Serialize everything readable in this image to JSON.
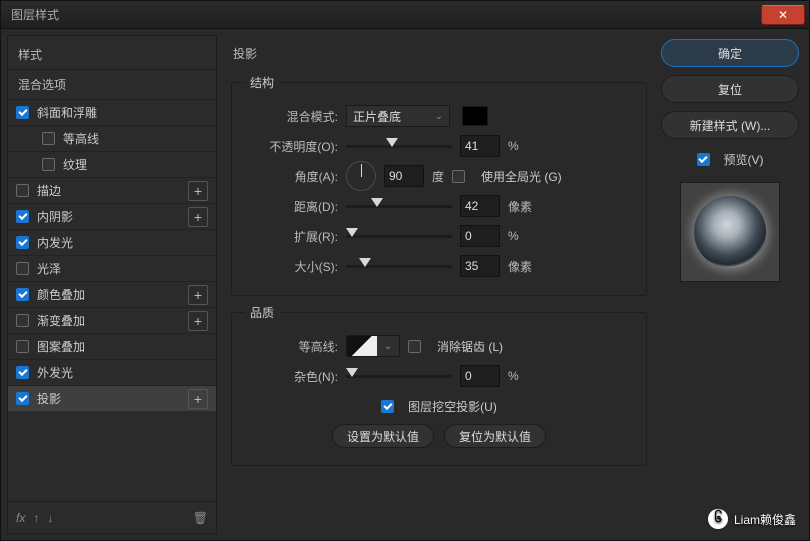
{
  "window": {
    "title": "图层样式"
  },
  "left": {
    "styles": "样式",
    "blendOptions": "混合选项",
    "items": [
      {
        "key": "bevel",
        "label": "斜面和浮雕",
        "checked": true,
        "plus": false
      },
      {
        "key": "contour",
        "label": "等高线",
        "checked": false,
        "plus": false,
        "indent": true
      },
      {
        "key": "texture",
        "label": "纹理",
        "checked": false,
        "plus": false,
        "indent": true
      },
      {
        "key": "stroke",
        "label": "描边",
        "checked": false,
        "plus": true
      },
      {
        "key": "innerShadow",
        "label": "内阴影",
        "checked": true,
        "plus": true
      },
      {
        "key": "innerGlow",
        "label": "内发光",
        "checked": true,
        "plus": false
      },
      {
        "key": "satin",
        "label": "光泽",
        "checked": false,
        "plus": false
      },
      {
        "key": "colorOverlay",
        "label": "颜色叠加",
        "checked": true,
        "plus": true
      },
      {
        "key": "gradOverlay",
        "label": "渐变叠加",
        "checked": false,
        "plus": true
      },
      {
        "key": "patOverlay",
        "label": "图案叠加",
        "checked": false,
        "plus": false
      },
      {
        "key": "outerGlow",
        "label": "外发光",
        "checked": true,
        "plus": false
      },
      {
        "key": "dropShadow",
        "label": "投影",
        "checked": true,
        "plus": true,
        "active": true
      }
    ],
    "fxLabel": "fx"
  },
  "mid": {
    "title": "投影",
    "structure": "结构",
    "quality": "品质",
    "blendModeLabel": "混合模式:",
    "blendModeValue": "正片叠底",
    "opacityLabel": "不透明度(O):",
    "opacityValue": "41",
    "opacityUnit": "%",
    "angleLabel": "角度(A):",
    "angleValue": "90",
    "angleUnit": "度",
    "useGlobal": "使用全局光 (G)",
    "distanceLabel": "距离(D):",
    "distanceValue": "42",
    "distanceUnit": "像素",
    "spreadLabel": "扩展(R):",
    "spreadValue": "0",
    "spreadUnit": "%",
    "sizeLabel": "大小(S):",
    "sizeValue": "35",
    "sizeUnit": "像素",
    "contourLabel": "等高线:",
    "antialias": "消除锯齿 (L)",
    "noiseLabel": "杂色(N):",
    "noiseValue": "0",
    "noiseUnit": "%",
    "knockout": "图层挖空投影(U)",
    "setDefault": "设置为默认值",
    "resetDefault": "复位为默认值"
  },
  "right": {
    "ok": "确定",
    "cancel": "复位",
    "newStyle": "新建样式 (W)...",
    "preview": "预览(V)"
  },
  "watermark": "Liam赖俊鑫"
}
